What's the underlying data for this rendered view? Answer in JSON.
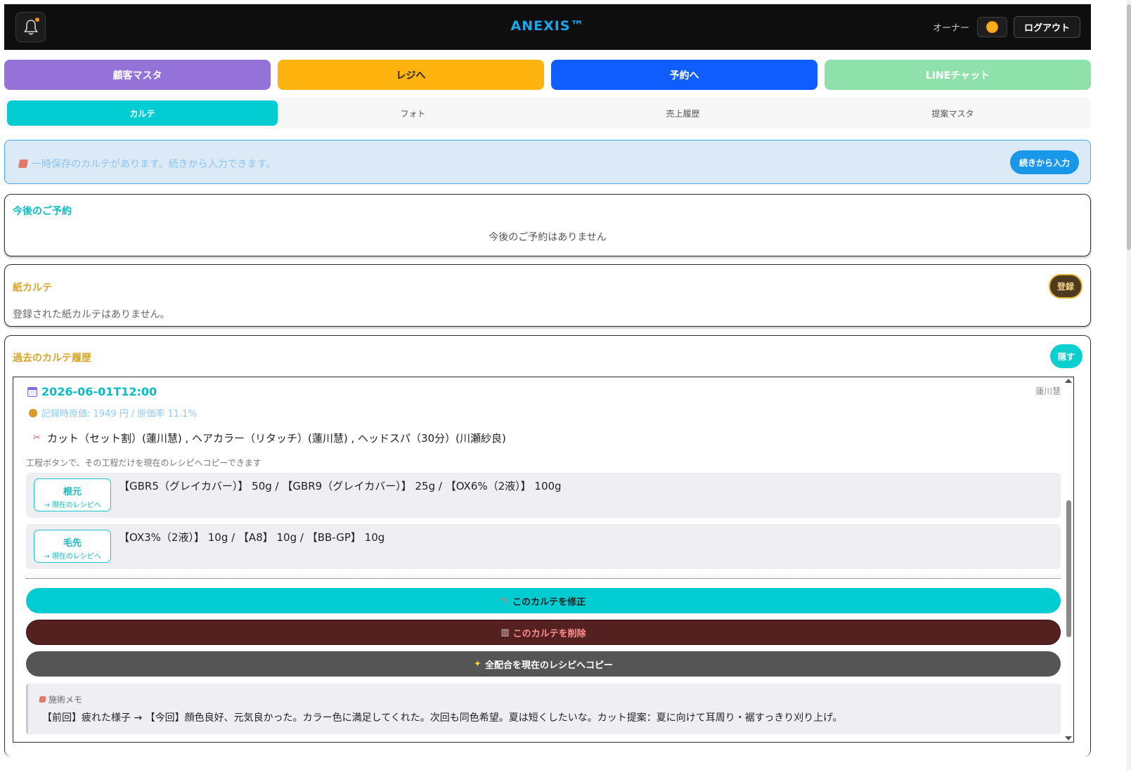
{
  "header": {
    "brand": "ANEXIS™",
    "role": "オーナー",
    "logout_label": "ログアウト"
  },
  "nav": [
    {
      "label": "顧客マスタ",
      "color": "#9572d8"
    },
    {
      "label": "レジへ",
      "color": "#ffb30f"
    },
    {
      "label": "予約へ",
      "color": "#0f5cff"
    },
    {
      "label": "LINEチャット",
      "color": "#8fe1ac"
    }
  ],
  "tabs": [
    "カルテ",
    "フォト",
    "売上履歴",
    "提案マスタ"
  ],
  "banner": {
    "message": "一時保存のカルテがあります。続きから入力できます。",
    "button": "続きから入力"
  },
  "upcoming": {
    "title": "今後のご予約",
    "empty": "今後のご予約はありません"
  },
  "paper": {
    "title": "紙カルテ",
    "button": "登録",
    "empty": "登録された紙カルテはありません。"
  },
  "history": {
    "title": "過去のカルテ履歴",
    "toggle": "隠す",
    "entry": {
      "datetime": "2026-06-01T12:00",
      "staff": "蓮川慧",
      "cost": "記録時原価: 1949 円 / 原価率 11.1%",
      "services": "カット（セット割）(蓮川慧) , ヘアカラー（リタッチ）(蓮川慧) , ヘッドスパ（30分）(川瀬紗良)",
      "hint": "工程ボタンで、その工程だけを現在のレシピへコピーできます",
      "steps": [
        {
          "name": "根元",
          "copy": "→ 現在のレシピへ",
          "recipe": "【GBR5（グレイカバー）】 50g / 【GBR9（グレイカバー）】 25g / 【OX6%（2液）】 100g"
        },
        {
          "name": "毛先",
          "copy": "→ 現在のレシピへ",
          "recipe": "【OX3%（2液）】 10g / 【A8】 10g / 【BB-GP】 10g"
        }
      ],
      "edit_label": "このカルテを修正",
      "delete_label": "このカルテを削除",
      "copy_all_label": "全配合を現在のレシピへコピー",
      "memo_label": "施術メモ",
      "memo_text": "【前回】疲れた様子 → 【今回】顔色良好、元気良かった。カラー色に満足してくれた。次回も同色希望。夏は短くしたいな。カット提案：夏に向けて耳周り・裾すっきり刈り上げ。"
    }
  },
  "colors": {
    "accent": "#01ccd1",
    "gold": "#d8a72a",
    "delete": "#552020",
    "gray": "#555555"
  }
}
